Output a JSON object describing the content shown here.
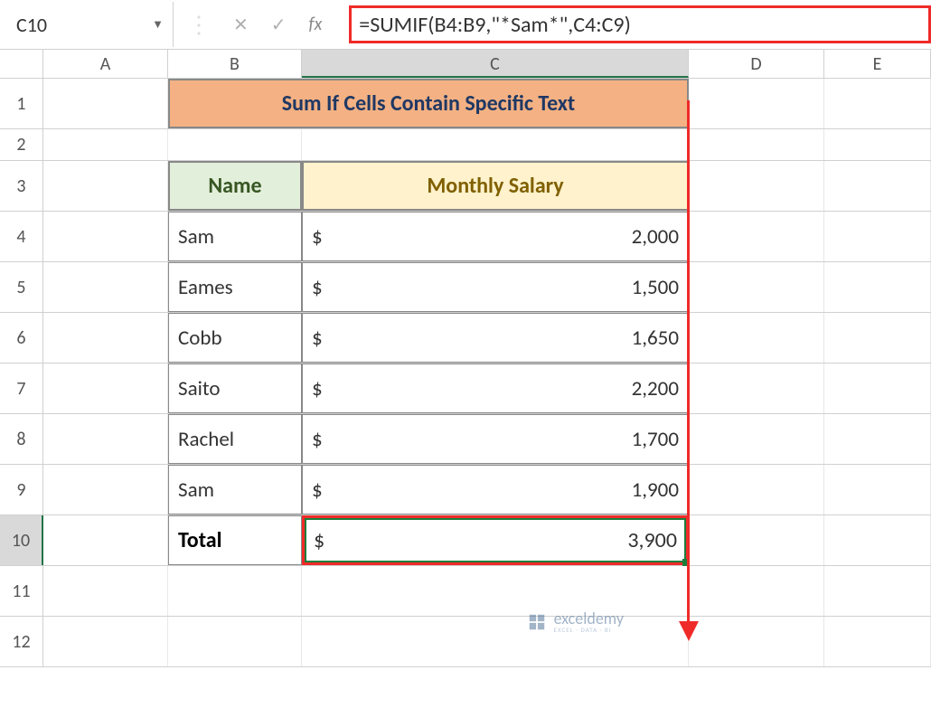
{
  "nameBox": "C10",
  "formula": "=SUMIF(B4:B9,\"*Sam*\",C4:C9)",
  "columns": {
    "A": "A",
    "B": "B",
    "C": "C",
    "D": "D",
    "E": "E"
  },
  "rowNumbers": [
    "1",
    "2",
    "3",
    "4",
    "5",
    "6",
    "7",
    "8",
    "9",
    "10",
    "11",
    "12"
  ],
  "titleRow": "Sum If Cells Contain Specific Text",
  "headers": {
    "name": "Name",
    "salary": "Monthly Salary"
  },
  "currency": "$",
  "data": [
    {
      "name": "Sam",
      "salary": "2,000"
    },
    {
      "name": "Eames",
      "salary": "1,500"
    },
    {
      "name": "Cobb",
      "salary": "1,650"
    },
    {
      "name": "Saito",
      "salary": "2,200"
    },
    {
      "name": "Rachel",
      "salary": "1,700"
    },
    {
      "name": "Sam",
      "salary": "1,900"
    }
  ],
  "total": {
    "label": "Total",
    "value": "3,900"
  },
  "watermark": {
    "text": "exceldemy",
    "sub": "EXCEL · DATA · BI"
  }
}
